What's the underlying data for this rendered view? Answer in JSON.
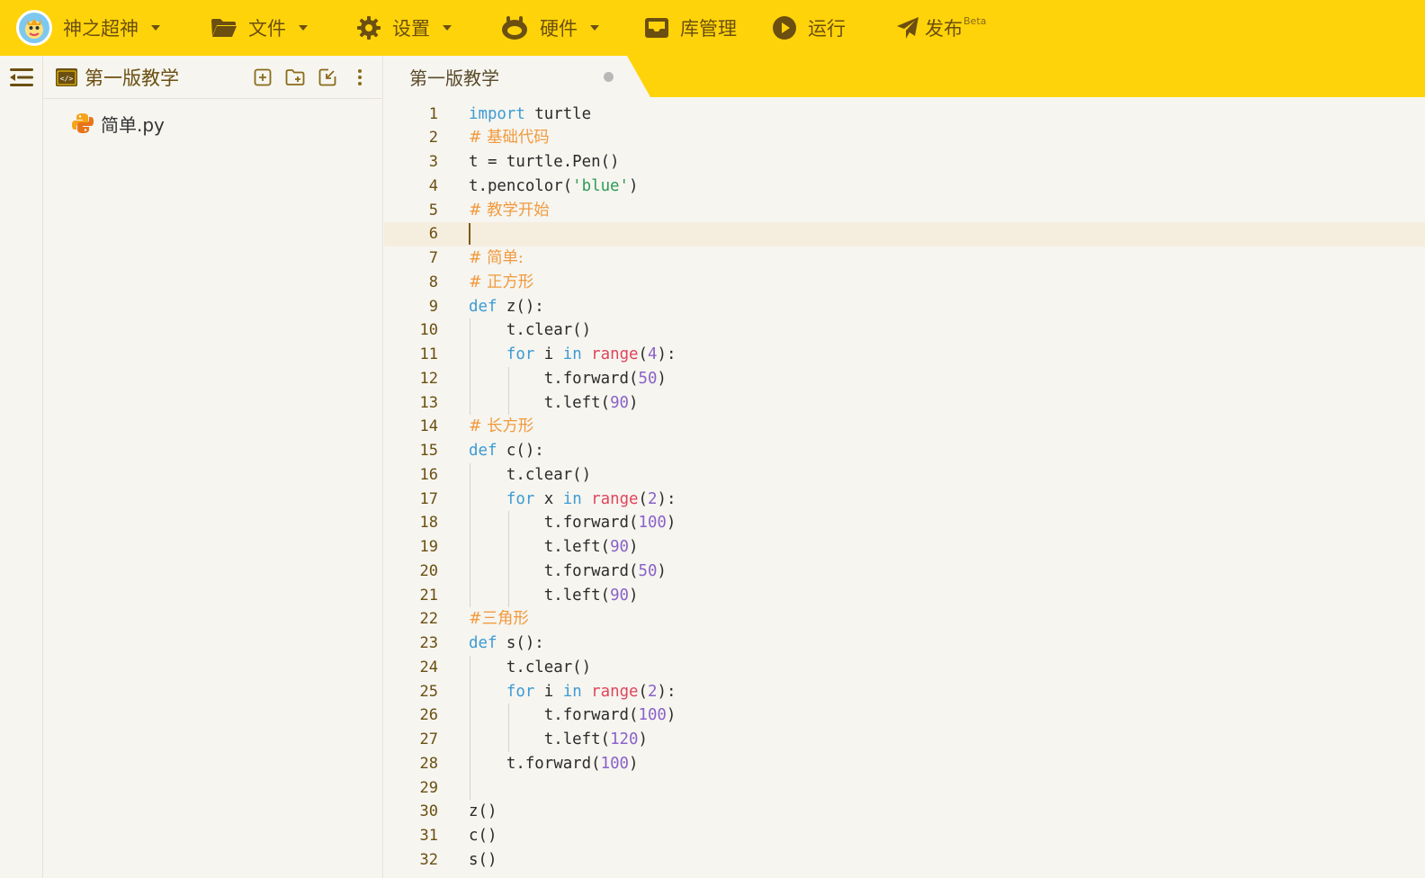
{
  "colors": {
    "topbar": "#ffd30a",
    "text_brown": "#6b4f10",
    "keyword": "#3d9bd3",
    "builtin": "#e0455b",
    "number": "#8a62c8",
    "string": "#2e9b57",
    "comment": "#f19a3e",
    "active_line": "#f5edde"
  },
  "topbar": {
    "user": {
      "name": "神之超神",
      "icon": "avatar-icon"
    },
    "menus": [
      {
        "label": "文件",
        "icon": "folder-icon",
        "dropdown": true
      },
      {
        "label": "设置",
        "icon": "gear-icon",
        "dropdown": true
      },
      {
        "label": "硬件",
        "icon": "hardware-icon",
        "dropdown": true
      },
      {
        "label": "库管理",
        "icon": "library-icon",
        "dropdown": false
      },
      {
        "label": "运行",
        "icon": "play-icon",
        "dropdown": false
      },
      {
        "label": "发布",
        "icon": "paper-plane-icon",
        "badge": "Beta",
        "dropdown": false
      }
    ]
  },
  "explorer": {
    "project_title": "第一版教学",
    "files": [
      {
        "name": "简单.py",
        "icon": "python-icon"
      }
    ]
  },
  "tabs": [
    {
      "label": "第一版教学",
      "modified": true
    }
  ],
  "editor": {
    "active_line": 6,
    "lines": [
      [
        [
          "kw",
          "import"
        ],
        [
          "p",
          " turtle"
        ]
      ],
      [
        [
          "cm",
          "# 基础代码"
        ]
      ],
      [
        [
          "p",
          "t = turtle.Pen()"
        ]
      ],
      [
        [
          "p",
          "t.pencolor("
        ],
        [
          "str",
          "'blue'"
        ],
        [
          "p",
          ")"
        ]
      ],
      [
        [
          "cm",
          "# 教学开始"
        ]
      ],
      [],
      [
        [
          "cm",
          "# 简单:"
        ]
      ],
      [
        [
          "cm",
          "# 正方形"
        ]
      ],
      [
        [
          "kw",
          "def"
        ],
        [
          "p",
          " z():"
        ]
      ],
      [
        [
          "p",
          "    t.clear()"
        ]
      ],
      [
        [
          "p",
          "    "
        ],
        [
          "kw",
          "for"
        ],
        [
          "p",
          " i "
        ],
        [
          "kw",
          "in"
        ],
        [
          "p",
          " "
        ],
        [
          "bi",
          "range"
        ],
        [
          "p",
          "("
        ],
        [
          "num",
          "4"
        ],
        [
          "p",
          "):"
        ]
      ],
      [
        [
          "p",
          "        t.forward("
        ],
        [
          "num",
          "50"
        ],
        [
          "p",
          ")"
        ]
      ],
      [
        [
          "p",
          "        t.left("
        ],
        [
          "num",
          "90"
        ],
        [
          "p",
          ")"
        ]
      ],
      [
        [
          "cm",
          "# 长方形"
        ]
      ],
      [
        [
          "kw",
          "def"
        ],
        [
          "p",
          " c():"
        ]
      ],
      [
        [
          "p",
          "    t.clear()"
        ]
      ],
      [
        [
          "p",
          "    "
        ],
        [
          "kw",
          "for"
        ],
        [
          "p",
          " x "
        ],
        [
          "kw",
          "in"
        ],
        [
          "p",
          " "
        ],
        [
          "bi",
          "range"
        ],
        [
          "p",
          "("
        ],
        [
          "num",
          "2"
        ],
        [
          "p",
          "):"
        ]
      ],
      [
        [
          "p",
          "        t.forward("
        ],
        [
          "num",
          "100"
        ],
        [
          "p",
          ")"
        ]
      ],
      [
        [
          "p",
          "        t.left("
        ],
        [
          "num",
          "90"
        ],
        [
          "p",
          ")"
        ]
      ],
      [
        [
          "p",
          "        t.forward("
        ],
        [
          "num",
          "50"
        ],
        [
          "p",
          ")"
        ]
      ],
      [
        [
          "p",
          "        t.left("
        ],
        [
          "num",
          "90"
        ],
        [
          "p",
          ")"
        ]
      ],
      [
        [
          "cm",
          "#三角形"
        ]
      ],
      [
        [
          "kw",
          "def"
        ],
        [
          "p",
          " s():"
        ]
      ],
      [
        [
          "p",
          "    t.clear()"
        ]
      ],
      [
        [
          "p",
          "    "
        ],
        [
          "kw",
          "for"
        ],
        [
          "p",
          " i "
        ],
        [
          "kw",
          "in"
        ],
        [
          "p",
          " "
        ],
        [
          "bi",
          "range"
        ],
        [
          "p",
          "("
        ],
        [
          "num",
          "2"
        ],
        [
          "p",
          "):"
        ]
      ],
      [
        [
          "p",
          "        t.forward("
        ],
        [
          "num",
          "100"
        ],
        [
          "p",
          ")"
        ]
      ],
      [
        [
          "p",
          "        t.left("
        ],
        [
          "num",
          "120"
        ],
        [
          "p",
          ")"
        ]
      ],
      [
        [
          "p",
          "    t.forward("
        ],
        [
          "num",
          "100"
        ],
        [
          "p",
          ")"
        ]
      ],
      [],
      [
        [
          "p",
          "z()"
        ]
      ],
      [
        [
          "p",
          "c()"
        ]
      ],
      [
        [
          "p",
          "s()"
        ]
      ]
    ]
  }
}
